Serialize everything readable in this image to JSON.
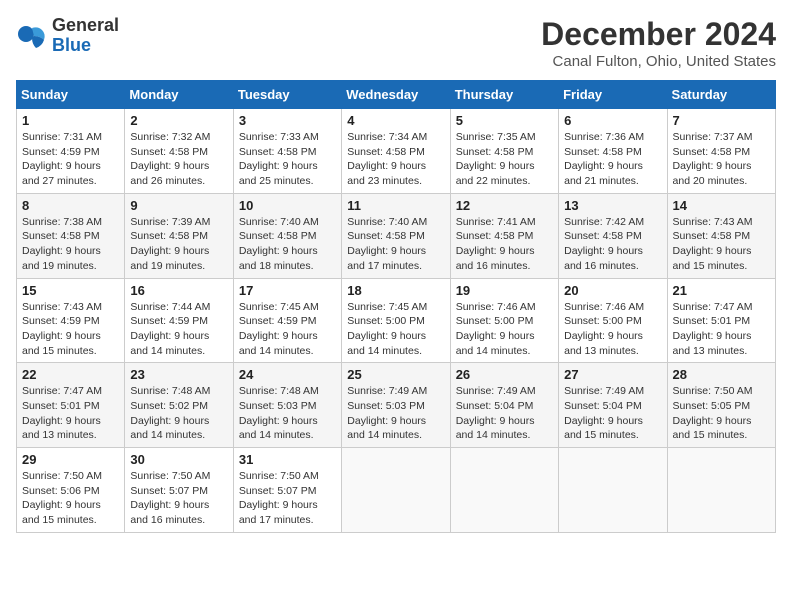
{
  "logo": {
    "line1": "General",
    "line2": "Blue"
  },
  "title": "December 2024",
  "subtitle": "Canal Fulton, Ohio, United States",
  "days_of_week": [
    "Sunday",
    "Monday",
    "Tuesday",
    "Wednesday",
    "Thursday",
    "Friday",
    "Saturday"
  ],
  "weeks": [
    [
      {
        "day": "1",
        "sunrise": "Sunrise: 7:31 AM",
        "sunset": "Sunset: 4:59 PM",
        "daylight": "Daylight: 9 hours and 27 minutes."
      },
      {
        "day": "2",
        "sunrise": "Sunrise: 7:32 AM",
        "sunset": "Sunset: 4:58 PM",
        "daylight": "Daylight: 9 hours and 26 minutes."
      },
      {
        "day": "3",
        "sunrise": "Sunrise: 7:33 AM",
        "sunset": "Sunset: 4:58 PM",
        "daylight": "Daylight: 9 hours and 25 minutes."
      },
      {
        "day": "4",
        "sunrise": "Sunrise: 7:34 AM",
        "sunset": "Sunset: 4:58 PM",
        "daylight": "Daylight: 9 hours and 23 minutes."
      },
      {
        "day": "5",
        "sunrise": "Sunrise: 7:35 AM",
        "sunset": "Sunset: 4:58 PM",
        "daylight": "Daylight: 9 hours and 22 minutes."
      },
      {
        "day": "6",
        "sunrise": "Sunrise: 7:36 AM",
        "sunset": "Sunset: 4:58 PM",
        "daylight": "Daylight: 9 hours and 21 minutes."
      },
      {
        "day": "7",
        "sunrise": "Sunrise: 7:37 AM",
        "sunset": "Sunset: 4:58 PM",
        "daylight": "Daylight: 9 hours and 20 minutes."
      }
    ],
    [
      {
        "day": "8",
        "sunrise": "Sunrise: 7:38 AM",
        "sunset": "Sunset: 4:58 PM",
        "daylight": "Daylight: 9 hours and 19 minutes."
      },
      {
        "day": "9",
        "sunrise": "Sunrise: 7:39 AM",
        "sunset": "Sunset: 4:58 PM",
        "daylight": "Daylight: 9 hours and 19 minutes."
      },
      {
        "day": "10",
        "sunrise": "Sunrise: 7:40 AM",
        "sunset": "Sunset: 4:58 PM",
        "daylight": "Daylight: 9 hours and 18 minutes."
      },
      {
        "day": "11",
        "sunrise": "Sunrise: 7:40 AM",
        "sunset": "Sunset: 4:58 PM",
        "daylight": "Daylight: 9 hours and 17 minutes."
      },
      {
        "day": "12",
        "sunrise": "Sunrise: 7:41 AM",
        "sunset": "Sunset: 4:58 PM",
        "daylight": "Daylight: 9 hours and 16 minutes."
      },
      {
        "day": "13",
        "sunrise": "Sunrise: 7:42 AM",
        "sunset": "Sunset: 4:58 PM",
        "daylight": "Daylight: 9 hours and 16 minutes."
      },
      {
        "day": "14",
        "sunrise": "Sunrise: 7:43 AM",
        "sunset": "Sunset: 4:58 PM",
        "daylight": "Daylight: 9 hours and 15 minutes."
      }
    ],
    [
      {
        "day": "15",
        "sunrise": "Sunrise: 7:43 AM",
        "sunset": "Sunset: 4:59 PM",
        "daylight": "Daylight: 9 hours and 15 minutes."
      },
      {
        "day": "16",
        "sunrise": "Sunrise: 7:44 AM",
        "sunset": "Sunset: 4:59 PM",
        "daylight": "Daylight: 9 hours and 14 minutes."
      },
      {
        "day": "17",
        "sunrise": "Sunrise: 7:45 AM",
        "sunset": "Sunset: 4:59 PM",
        "daylight": "Daylight: 9 hours and 14 minutes."
      },
      {
        "day": "18",
        "sunrise": "Sunrise: 7:45 AM",
        "sunset": "Sunset: 5:00 PM",
        "daylight": "Daylight: 9 hours and 14 minutes."
      },
      {
        "day": "19",
        "sunrise": "Sunrise: 7:46 AM",
        "sunset": "Sunset: 5:00 PM",
        "daylight": "Daylight: 9 hours and 14 minutes."
      },
      {
        "day": "20",
        "sunrise": "Sunrise: 7:46 AM",
        "sunset": "Sunset: 5:00 PM",
        "daylight": "Daylight: 9 hours and 13 minutes."
      },
      {
        "day": "21",
        "sunrise": "Sunrise: 7:47 AM",
        "sunset": "Sunset: 5:01 PM",
        "daylight": "Daylight: 9 hours and 13 minutes."
      }
    ],
    [
      {
        "day": "22",
        "sunrise": "Sunrise: 7:47 AM",
        "sunset": "Sunset: 5:01 PM",
        "daylight": "Daylight: 9 hours and 13 minutes."
      },
      {
        "day": "23",
        "sunrise": "Sunrise: 7:48 AM",
        "sunset": "Sunset: 5:02 PM",
        "daylight": "Daylight: 9 hours and 14 minutes."
      },
      {
        "day": "24",
        "sunrise": "Sunrise: 7:48 AM",
        "sunset": "Sunset: 5:03 PM",
        "daylight": "Daylight: 9 hours and 14 minutes."
      },
      {
        "day": "25",
        "sunrise": "Sunrise: 7:49 AM",
        "sunset": "Sunset: 5:03 PM",
        "daylight": "Daylight: 9 hours and 14 minutes."
      },
      {
        "day": "26",
        "sunrise": "Sunrise: 7:49 AM",
        "sunset": "Sunset: 5:04 PM",
        "daylight": "Daylight: 9 hours and 14 minutes."
      },
      {
        "day": "27",
        "sunrise": "Sunrise: 7:49 AM",
        "sunset": "Sunset: 5:04 PM",
        "daylight": "Daylight: 9 hours and 15 minutes."
      },
      {
        "day": "28",
        "sunrise": "Sunrise: 7:50 AM",
        "sunset": "Sunset: 5:05 PM",
        "daylight": "Daylight: 9 hours and 15 minutes."
      }
    ],
    [
      {
        "day": "29",
        "sunrise": "Sunrise: 7:50 AM",
        "sunset": "Sunset: 5:06 PM",
        "daylight": "Daylight: 9 hours and 15 minutes."
      },
      {
        "day": "30",
        "sunrise": "Sunrise: 7:50 AM",
        "sunset": "Sunset: 5:07 PM",
        "daylight": "Daylight: 9 hours and 16 minutes."
      },
      {
        "day": "31",
        "sunrise": "Sunrise: 7:50 AM",
        "sunset": "Sunset: 5:07 PM",
        "daylight": "Daylight: 9 hours and 17 minutes."
      },
      null,
      null,
      null,
      null
    ]
  ]
}
